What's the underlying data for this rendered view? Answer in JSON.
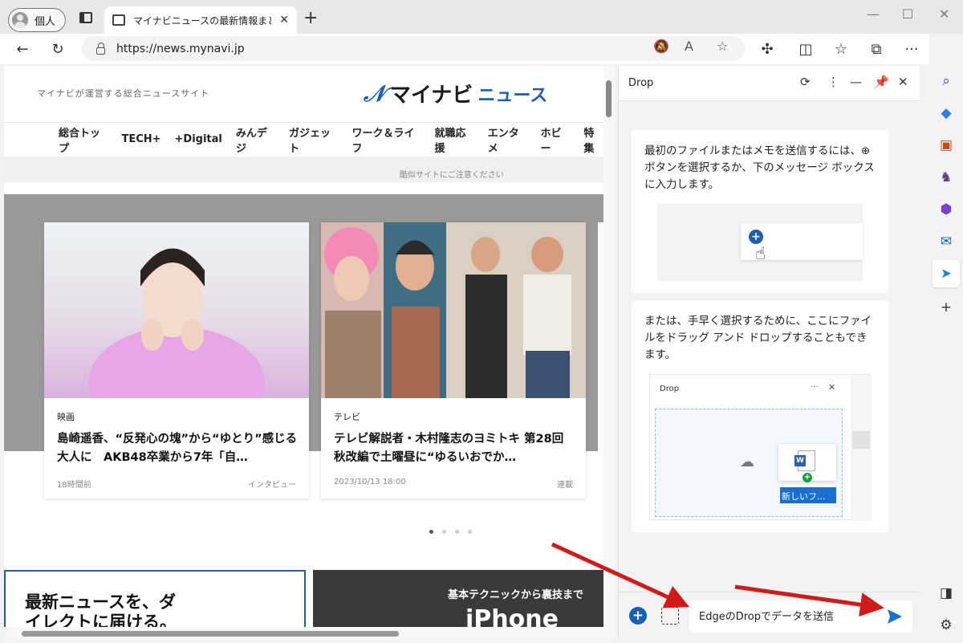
{
  "browser": {
    "profile_label": "個人",
    "tab_title": "マイナビニュースの最新情報まとめ - エ",
    "url": "https://news.mynavi.jp"
  },
  "page": {
    "tagline": "マイナビが運営する総合ニュースサイト",
    "logo_main": "マイナビ",
    "logo_sub": "ニュース",
    "nav": [
      "総合トップ",
      "TECH+",
      "+Digital",
      "みんデジ",
      "ガジェット",
      "ワーク＆ライフ",
      "就職応援",
      "エンタメ",
      "ホビー",
      "特集"
    ],
    "notice": "酷似サイトにご注意ください",
    "cards": [
      {
        "category": "映画",
        "title": "島崎遥香、“反発心の塊”から“ゆとり”感じる大人に　AKB48卒業から7年「自…",
        "date": "18時間前",
        "label": "インタビュー"
      },
      {
        "category": "テレビ",
        "title": "テレビ解説者・木村隆志のヨミトキ 第28回 秋改編で土曜昼に“ゆるいおでか…",
        "date": "2023/10/13 18:00",
        "label": "連載"
      }
    ],
    "banner_left": "最新ニュースを、ダイレクトに届ける。",
    "banner_right_sub": "基本テクニックから裏技まで",
    "banner_right_main": "iPhone"
  },
  "drop": {
    "title": "Drop",
    "card1_text": "最初のファイルまたはメモを送信するには、⊕ ボタンを選択するか、下のメッセージ ボックスに入力します。",
    "card2_text": "または、手早く選択するために、ここにファイルをドラッグ アンド ドロップすることもできます。",
    "illus_title": "Drop",
    "illus_filename": "新しいフ...",
    "message_placeholder": "EdgeのDropでデータを送信"
  },
  "colors": {
    "accent": "#1a5fb4",
    "arrow": "#d11a1a"
  }
}
